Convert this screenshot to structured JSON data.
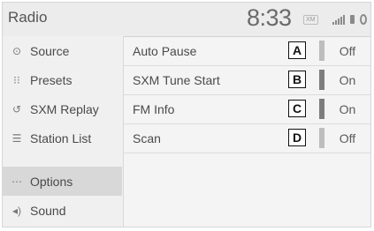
{
  "header": {
    "title": "Radio",
    "time": "8:33",
    "status_badge": "XM",
    "status_icons": [
      "signal-icon",
      "phone-icon",
      "edge-icon"
    ]
  },
  "sidebar": {
    "items": [
      {
        "label": "Source",
        "icon": "source-icon",
        "glyph": "⊙"
      },
      {
        "label": "Presets",
        "icon": "presets-icon",
        "glyph": "⁝⁝"
      },
      {
        "label": "SXM Replay",
        "icon": "replay-icon",
        "glyph": "↺"
      },
      {
        "label": "Station List",
        "icon": "station-list-icon",
        "glyph": "☰"
      },
      {
        "label": "Options",
        "icon": "options-icon",
        "glyph": "⋯",
        "active": true
      },
      {
        "label": "Sound",
        "icon": "sound-icon",
        "glyph": "◂)"
      }
    ]
  },
  "options": [
    {
      "label": "Auto Pause",
      "callout": "A",
      "value": "Off",
      "on": false
    },
    {
      "label": "SXM Tune Start",
      "callout": "B",
      "value": "On",
      "on": true
    },
    {
      "label": "FM Info",
      "callout": "C",
      "value": "On",
      "on": true
    },
    {
      "label": "Scan",
      "callout": "D",
      "value": "Off",
      "on": false
    }
  ]
}
